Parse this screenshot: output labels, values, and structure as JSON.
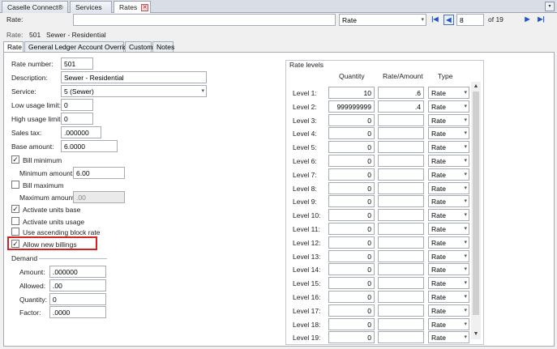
{
  "tabs": [
    {
      "label": "Caselle Connect®"
    },
    {
      "label": "Services"
    },
    {
      "label": "Rates"
    }
  ],
  "toolbar": {
    "rate_label": "Rate:",
    "rate_value": "",
    "rate_select": "Rate",
    "record_number": "8",
    "record_of": "of 19"
  },
  "record": {
    "label": "Rate:",
    "number": "501",
    "name": "Sewer - Residential"
  },
  "subtabs": [
    {
      "label": "Rate"
    },
    {
      "label": "General Ledger Account Override"
    },
    {
      "label": "Custom"
    },
    {
      "label": "Notes"
    }
  ],
  "form": {
    "rate_number": {
      "label": "Rate number:",
      "value": "501"
    },
    "description": {
      "label": "Description:",
      "value": "Sewer - Residential"
    },
    "service": {
      "label": "Service:",
      "value": "5 (Sewer)"
    },
    "low_usage_limit": {
      "label": "Low usage limit:",
      "value": "0"
    },
    "high_usage_limit": {
      "label": "High usage limit:",
      "value": "0"
    },
    "sales_tax": {
      "label": "Sales tax:",
      "value": ".000000"
    },
    "base_amount": {
      "label": "Base amount:",
      "value": "6.0000"
    },
    "bill_minimum": {
      "label": "Bill minimum",
      "checked": true
    },
    "minimum_amount": {
      "label": "Minimum amount:",
      "value": "6.00"
    },
    "bill_maximum": {
      "label": "Bill maximum",
      "checked": false
    },
    "maximum_amount": {
      "label": "Maximum amount:",
      "value": ".00"
    },
    "activate_units_base": {
      "label": "Activate units base",
      "checked": true
    },
    "activate_units_usage": {
      "label": "Activate units usage",
      "checked": false
    },
    "use_ascending_block_rate": {
      "label": "Use ascending block rate",
      "checked": false
    },
    "allow_new_billings": {
      "label": "Allow new billings",
      "checked": true
    }
  },
  "demand": {
    "title": "Demand",
    "amount": {
      "label": "Amount:",
      "value": ".000000"
    },
    "allowed": {
      "label": "Allowed:",
      "value": ".00"
    },
    "quantity": {
      "label": "Quantity:",
      "value": "0"
    },
    "factor": {
      "label": "Factor:",
      "value": ".0000"
    }
  },
  "rate_levels": {
    "title": "Rate levels",
    "headers": {
      "quantity": "Quantity",
      "rate_amount": "Rate/Amount",
      "type": "Type"
    },
    "rows": [
      {
        "label": "Level 1:",
        "quantity": "10",
        "rate": ".6",
        "type": "Rate"
      },
      {
        "label": "Level 2:",
        "quantity": "999999999",
        "rate": ".4",
        "type": "Rate"
      },
      {
        "label": "Level 3:",
        "quantity": "0",
        "rate": "",
        "type": "Rate"
      },
      {
        "label": "Level 4:",
        "quantity": "0",
        "rate": "",
        "type": "Rate"
      },
      {
        "label": "Level 5:",
        "quantity": "0",
        "rate": "",
        "type": "Rate"
      },
      {
        "label": "Level 6:",
        "quantity": "0",
        "rate": "",
        "type": "Rate"
      },
      {
        "label": "Level 7:",
        "quantity": "0",
        "rate": "",
        "type": "Rate"
      },
      {
        "label": "Level 8:",
        "quantity": "0",
        "rate": "",
        "type": "Rate"
      },
      {
        "label": "Level 9:",
        "quantity": "0",
        "rate": "",
        "type": "Rate"
      },
      {
        "label": "Level 10:",
        "quantity": "0",
        "rate": "",
        "type": "Rate"
      },
      {
        "label": "Level 11:",
        "quantity": "0",
        "rate": "",
        "type": "Rate"
      },
      {
        "label": "Level 12:",
        "quantity": "0",
        "rate": "",
        "type": "Rate"
      },
      {
        "label": "Level 13:",
        "quantity": "0",
        "rate": "",
        "type": "Rate"
      },
      {
        "label": "Level 14:",
        "quantity": "0",
        "rate": "",
        "type": "Rate"
      },
      {
        "label": "Level 15:",
        "quantity": "0",
        "rate": "",
        "type": "Rate"
      },
      {
        "label": "Level 16:",
        "quantity": "0",
        "rate": "",
        "type": "Rate"
      },
      {
        "label": "Level 17:",
        "quantity": "0",
        "rate": "",
        "type": "Rate"
      },
      {
        "label": "Level 18:",
        "quantity": "0",
        "rate": "",
        "type": "Rate"
      },
      {
        "label": "Level 19:",
        "quantity": "0",
        "rate": "",
        "type": "Rate"
      }
    ]
  },
  "icons": {
    "check": "✓",
    "chevron": "▾",
    "close": "✕",
    "first": "|◀",
    "prev": "◀",
    "next": "▶",
    "last": "▶|",
    "scroll_up": "▲",
    "scroll_down": "▼"
  },
  "colors": {
    "highlight": "#d42121",
    "nav": "#1f56c7"
  }
}
